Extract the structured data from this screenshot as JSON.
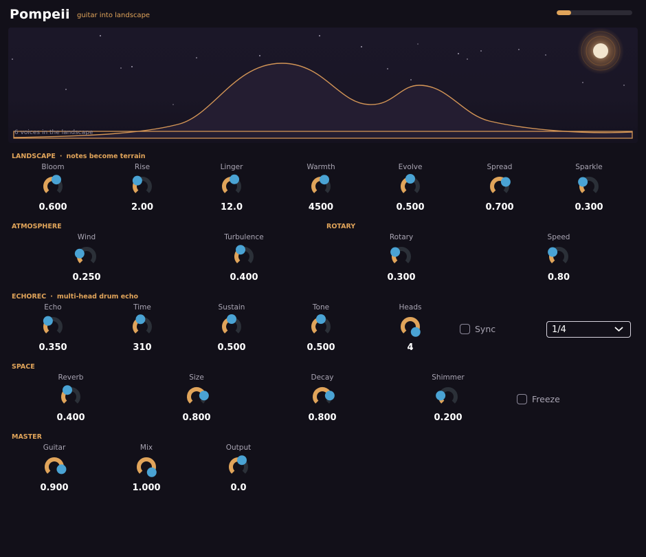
{
  "app": {
    "title": "Pompeii",
    "subtitle": "guitar into landscape",
    "level_meter": 0.19
  },
  "colors": {
    "accent": "#e0a45a",
    "knob_pointer": "#4aa3d4",
    "knob_track": "#2b3038",
    "background": "#121019"
  },
  "landscape": {
    "caption": "6 voices in the landscape"
  },
  "sections": {
    "landscape": {
      "title": "LANDSCAPE",
      "sep": "·",
      "subtitle": "notes become terrain"
    },
    "atmosphere": {
      "title": "ATMOSPHERE"
    },
    "rotary": {
      "title": "ROTARY"
    },
    "echorec": {
      "title": "ECHOREC",
      "sep": "·",
      "subtitle": "multi-head drum echo"
    },
    "space": {
      "title": "SPACE"
    },
    "master": {
      "title": "MASTER"
    }
  },
  "knobs": {
    "bloom": {
      "label": "Bloom",
      "value": "0.600",
      "norm": 0.6
    },
    "rise": {
      "label": "Rise",
      "value": "2.00",
      "norm": 0.35
    },
    "linger": {
      "label": "Linger",
      "value": "12.0",
      "norm": 0.58
    },
    "warmth": {
      "label": "Warmth",
      "value": "4500",
      "norm": 0.6
    },
    "evolve": {
      "label": "Evolve",
      "value": "0.500",
      "norm": 0.5
    },
    "spread": {
      "label": "Spread",
      "value": "0.700",
      "norm": 0.7
    },
    "sparkle": {
      "label": "Sparkle",
      "value": "0.300",
      "norm": 0.3
    },
    "wind": {
      "label": "Wind",
      "value": "0.250",
      "norm": 0.25
    },
    "turbulence": {
      "label": "Turbulence",
      "value": "0.400",
      "norm": 0.4
    },
    "rotary": {
      "label": "Rotary",
      "value": "0.300",
      "norm": 0.3
    },
    "speed": {
      "label": "Speed",
      "value": "0.80",
      "norm": 0.3
    },
    "echo": {
      "label": "Echo",
      "value": "0.350",
      "norm": 0.35
    },
    "time": {
      "label": "Time",
      "value": "310",
      "norm": 0.45
    },
    "sustain": {
      "label": "Sustain",
      "value": "0.500",
      "norm": 0.5
    },
    "tone": {
      "label": "Tone",
      "value": "0.500",
      "norm": 0.5
    },
    "heads": {
      "label": "Heads",
      "value": "4",
      "norm": 1.0
    },
    "reverb": {
      "label": "Reverb",
      "value": "0.400",
      "norm": 0.4
    },
    "size": {
      "label": "Size",
      "value": "0.800",
      "norm": 0.8
    },
    "decay": {
      "label": "Decay",
      "value": "0.800",
      "norm": 0.8
    },
    "shimmer": {
      "label": "Shimmer",
      "value": "0.200",
      "norm": 0.2
    },
    "guitar": {
      "label": "Guitar",
      "value": "0.900",
      "norm": 0.9
    },
    "mix": {
      "label": "Mix",
      "value": "1.000",
      "norm": 1.0
    },
    "output": {
      "label": "Output",
      "value": "0.0",
      "norm": 0.6
    }
  },
  "toggles": {
    "sync": {
      "label": "Sync",
      "checked": false
    },
    "freeze": {
      "label": "Freeze",
      "checked": false
    }
  },
  "dropdowns": {
    "division": {
      "value": "1/4"
    }
  }
}
